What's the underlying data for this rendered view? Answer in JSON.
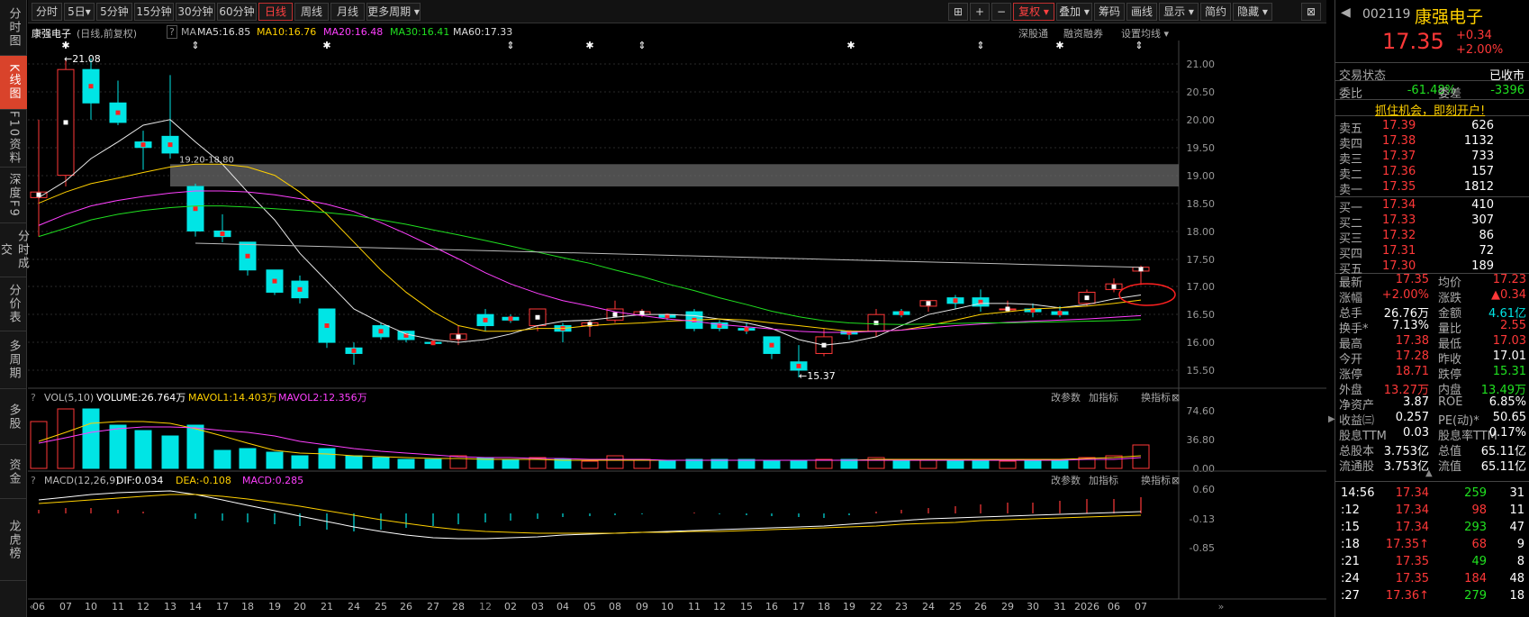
{
  "nav": [
    "分时图",
    "K线图",
    "F10资料",
    "深度F9",
    "分时成交",
    "分价表",
    "多周期",
    "多股",
    "资金",
    "龙虎榜"
  ],
  "toolbar": {
    "periods": [
      "分时",
      "5日▾",
      "5分钟",
      "15分钟",
      "30分钟",
      "60分钟",
      "日线",
      "周线",
      "月线",
      "更多周期 ▾"
    ],
    "right": [
      "复权 ▾",
      "叠加 ▾",
      "筹码",
      "画线",
      "显示 ▾",
      "简约",
      "隐藏 ▾"
    ]
  },
  "info": {
    "name": "康强电子",
    "mode": "(日线,前复权)",
    "ma_label": "MA",
    "ma5": "MA5:16.85",
    "ma10": "MA10:16.76",
    "ma20": "MA20:16.48",
    "ma30": "MA30:16.41",
    "ma60": "MA60:17.33",
    "links": [
      "深股通",
      "融资融券",
      "设置均线 ▾"
    ]
  },
  "price_axis": [
    "21.00",
    "20.50",
    "20.00",
    "19.50",
    "19.00",
    "18.50",
    "18.00",
    "17.50",
    "17.00",
    "16.50",
    "16.00",
    "15.50"
  ],
  "annotations": {
    "high": "←21.08",
    "low": "←15.37",
    "zone": "19.20-18.80"
  },
  "vol": {
    "title": "VOL(5,10)",
    "volume": "VOLUME:26.764万",
    "mavol1": "MAVOL1:14.403万",
    "mavol2": "MAVOL2:12.356万",
    "axis": [
      "74.60",
      "36.80",
      "0.00"
    ],
    "links": [
      "改参数",
      "加指标",
      "换指标"
    ]
  },
  "macd": {
    "title": "MACD(12,26,9)",
    "dif": "DIF:0.034",
    "dea": "DEA:-0.108",
    "macd": "MACD:0.285",
    "axis": [
      "0.60",
      "-0.13",
      "-0.85"
    ],
    "links": [
      "改参数",
      "加指标",
      "换指标"
    ]
  },
  "xaxis": [
    "06",
    "07",
    "10",
    "11",
    "12",
    "13",
    "14",
    "17",
    "18",
    "19",
    "20",
    "21",
    "24",
    "25",
    "26",
    "27",
    "28",
    "12",
    "02",
    "03",
    "04",
    "05",
    "08",
    "09",
    "10",
    "11",
    "12",
    "15",
    "16",
    "17",
    "18",
    "19",
    "22",
    "23",
    "24",
    "25",
    "26",
    "29",
    "30",
    "31",
    "2026",
    "06",
    "07"
  ],
  "stock": {
    "code": "002119",
    "name": "康强电子",
    "price": "17.35",
    "change": "+0.34",
    "pct": "+2.00%"
  },
  "status": {
    "label": "交易状态",
    "value": "已收市",
    "wb_label": "委比",
    "wb": "-61.48%",
    "wc_label": "委差",
    "wc": "-3396",
    "promo": "抓住机会，即刻开户!"
  },
  "asks": [
    {
      "n": "卖五",
      "p": "17.39",
      "v": "626"
    },
    {
      "n": "卖四",
      "p": "17.38",
      "v": "1132"
    },
    {
      "n": "卖三",
      "p": "17.37",
      "v": "733"
    },
    {
      "n": "卖二",
      "p": "17.36",
      "v": "157"
    },
    {
      "n": "卖一",
      "p": "17.35",
      "v": "1812"
    }
  ],
  "bids": [
    {
      "n": "买一",
      "p": "17.34",
      "v": "410"
    },
    {
      "n": "买二",
      "p": "17.33",
      "v": "307"
    },
    {
      "n": "买三",
      "p": "17.32",
      "v": "86"
    },
    {
      "n": "买四",
      "p": "17.31",
      "v": "72"
    },
    {
      "n": "买五",
      "p": "17.30",
      "v": "189"
    }
  ],
  "stats": [
    [
      "最新",
      "17.35",
      "均价",
      "17.23"
    ],
    [
      "涨幅",
      "+2.00%",
      "涨跌",
      "▲0.34"
    ],
    [
      "总手",
      "26.76万",
      "金额",
      "4.61亿"
    ],
    [
      "换手*",
      "7.13%",
      "量比",
      "2.55"
    ],
    [
      "最高",
      "17.38",
      "最低",
      "17.03"
    ],
    [
      "今开",
      "17.28",
      "昨收",
      "17.01"
    ],
    [
      "涨停",
      "18.71",
      "跌停",
      "15.31"
    ],
    [
      "外盘",
      "13.27万",
      "内盘",
      "13.49万"
    ],
    [
      "净资产",
      "3.87",
      "ROE",
      "6.85%"
    ],
    [
      "收益㈢",
      "0.257",
      "PE(动)*",
      "50.65"
    ],
    [
      "股息TTM",
      "0.03",
      "股息率TTM",
      "0.17%"
    ],
    [
      "总股本",
      "3.753亿",
      "总值",
      "65.11亿"
    ],
    [
      "流通股",
      "3.753亿",
      "流值",
      "65.11亿"
    ]
  ],
  "ticks": [
    [
      "14:56",
      "17.34",
      "259",
      "31"
    ],
    [
      ":12",
      "17.34",
      "98",
      "11"
    ],
    [
      ":15",
      "17.34",
      "293",
      "47"
    ],
    [
      ":18",
      "17.35↑",
      "68",
      "9"
    ],
    [
      ":21",
      "17.35",
      "49",
      "8"
    ],
    [
      ":24",
      "17.35",
      "184",
      "48"
    ],
    [
      ":27",
      "17.36↑",
      "279",
      "18"
    ]
  ]
}
